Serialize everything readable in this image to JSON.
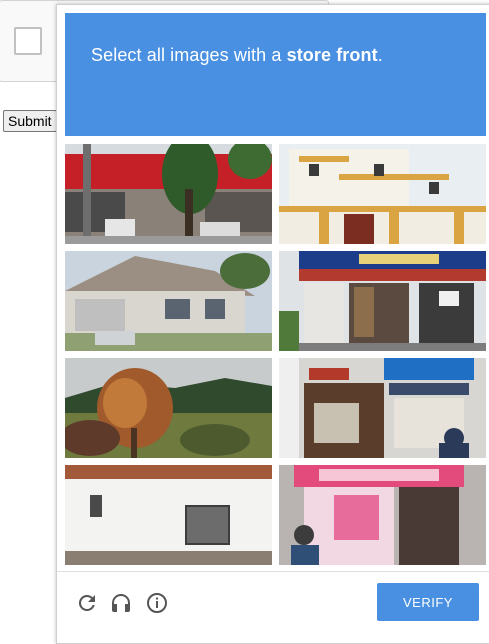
{
  "anchor": {
    "submit_label": "Submit"
  },
  "challenge": {
    "prompt_prefix": "Select all images with a ",
    "prompt_target": "store front",
    "prompt_suffix": ".",
    "header_color": "#4a90e2",
    "tiles": [
      {
        "id": "tile-1",
        "depicts": "storefront-red-awning"
      },
      {
        "id": "tile-2",
        "depicts": "white-villa"
      },
      {
        "id": "tile-3",
        "depicts": "suburban-house"
      },
      {
        "id": "tile-4",
        "depicts": "storefront-shop-signs"
      },
      {
        "id": "tile-5",
        "depicts": "autumn-tree-hills"
      },
      {
        "id": "tile-6",
        "depicts": "storefront-blue-sign"
      },
      {
        "id": "tile-7",
        "depicts": "white-house-wall"
      },
      {
        "id": "tile-8",
        "depicts": "storefront-pink-shop"
      }
    ],
    "footer": {
      "reload_icon": "reload-icon",
      "audio_icon": "headphones-icon",
      "info_icon": "info-icon",
      "verify_label": "VERIFY"
    }
  }
}
